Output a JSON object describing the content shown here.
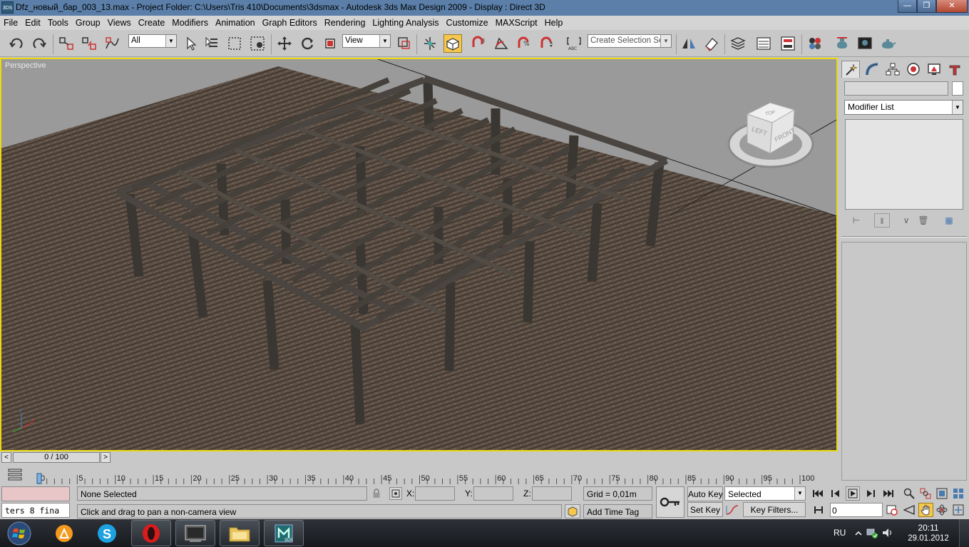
{
  "window": {
    "app_icon": "3DS",
    "title": "Dfz_новый_бар_003_13.max    - Project Folder: C:\\Users\\Tris 410\\Documents\\3dsmax     - Autodesk 3ds Max Design 2009      - Display : Direct 3D",
    "controls": [
      "minimize-icon",
      "restore-icon",
      "close-icon"
    ]
  },
  "menu": [
    "File",
    "Edit",
    "Tools",
    "Group",
    "Views",
    "Create",
    "Modifiers",
    "Animation",
    "Graph Editors",
    "Rendering",
    "Lighting Analysis",
    "Customize",
    "MAXScript",
    "Help"
  ],
  "toolbar": {
    "selection_filter": "All",
    "reference_coord": "View",
    "named_selection_placeholder": "Create Selection Set"
  },
  "viewport": {
    "label": "Perspective",
    "viewcube": {
      "top": "TOP",
      "front": "FRONT",
      "left": "LEFT"
    }
  },
  "command_panel": {
    "modifier_list": "Modifier List"
  },
  "timeline": {
    "slider": "0 / 100",
    "ticks": [
      "0",
      "5",
      "10",
      "15",
      "20",
      "25",
      "30",
      "35",
      "40",
      "45",
      "50",
      "55",
      "60",
      "65",
      "70",
      "75",
      "80",
      "85",
      "90",
      "95",
      "100"
    ]
  },
  "status": {
    "maxscript_listener": "ters 8 fina",
    "selection_info": "None Selected",
    "prompt": "Click and drag to pan a non-camera view",
    "x_label": "X:",
    "y_label": "Y:",
    "z_label": "Z:",
    "grid": "Grid = 0,01m",
    "add_time_tag": "Add Time Tag",
    "auto_key": "Auto Key",
    "set_key": "Set Key",
    "key_mode": "Selected",
    "key_filters": "Key Filters...",
    "frame": "0"
  },
  "taskbar": {
    "language": "RU",
    "time": "20:11",
    "date": "29.01.2012",
    "max_app_label": "3DS"
  },
  "colors": {
    "active_viewport_border": "#e9d812",
    "active_tool": "#f5c74f",
    "floor": "#5b4e44",
    "beam": "#3e3a35",
    "background": "#9a9a9a"
  }
}
